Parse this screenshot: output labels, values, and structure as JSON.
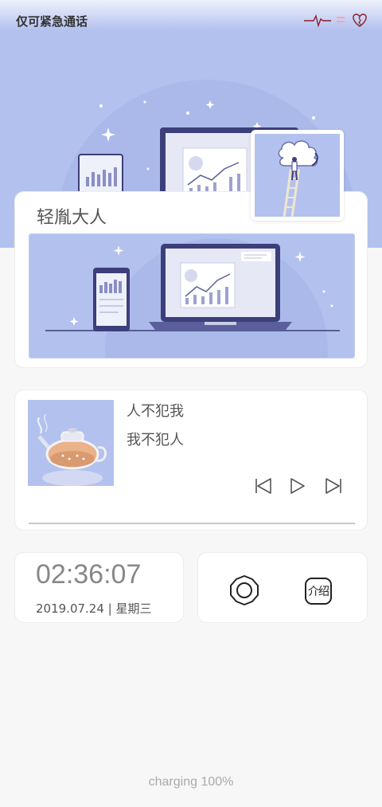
{
  "status_bar": {
    "title": "仅可紧急通话",
    "icons": [
      "heartbeat-icon",
      "charging-icon",
      "heart-icon"
    ]
  },
  "banner_card": {
    "title": "轻胤大人",
    "image": "devices-illustration",
    "thumbnail": "cloud-ladder-illustration"
  },
  "music_card": {
    "album_art": "teapot-photo",
    "line1": "人不犯我",
    "line2": "我不犯人",
    "controls": [
      "previous-icon",
      "play-icon",
      "next-icon"
    ],
    "progress": 0
  },
  "clock_card": {
    "time": "02:36:07",
    "date": "2019.07.24 | 星期三"
  },
  "actions_card": {
    "settings_icon": "settings-icon",
    "intro_label": "介绍"
  },
  "footer": {
    "charging_text": "charging 100%"
  },
  "colors": {
    "hero": "#b3c1ee",
    "card": "#ffffff",
    "background": "#f7f7f7"
  }
}
